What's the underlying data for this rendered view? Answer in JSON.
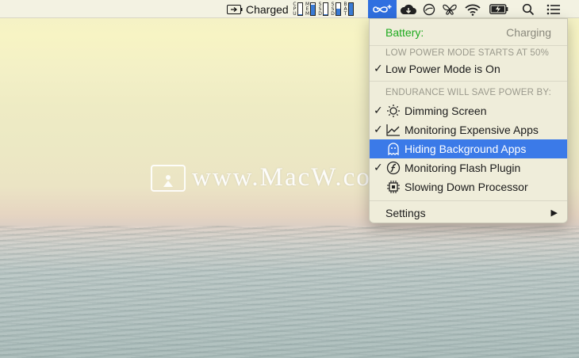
{
  "menubar": {
    "battery_status": "Charged",
    "stats": [
      {
        "label": "CPU",
        "level": 0.05,
        "fill_color": "#3a7bd5"
      },
      {
        "label": "MEM",
        "level": 0.85,
        "fill_color": "#3a7bd5"
      },
      {
        "label": "SSD",
        "level": 0.1,
        "fill_color": "#3a7bd5"
      },
      {
        "label": "SSD",
        "level": 0.55,
        "fill_color": "#3a7bd5"
      },
      {
        "label": "BAT",
        "level": 1.0,
        "fill_color": "#3a7bd5"
      }
    ],
    "icons": [
      "endurance-icon",
      "cloud-icon",
      "sync-icon",
      "butterfly-icon",
      "wifi-icon",
      "battery-charging-icon",
      "search-icon",
      "notification-list-icon"
    ]
  },
  "menu": {
    "battery_label": "Battery:",
    "battery_value": "Charging",
    "low_power_header": "LOW POWER MODE STARTS AT 50%",
    "low_power_item": "Low Power Mode is On",
    "endurance_header": "ENDURANCE WILL SAVE POWER BY:",
    "items": [
      {
        "label": "Dimming Screen",
        "checked": true,
        "icon": "brightness-icon"
      },
      {
        "label": "Monitoring Expensive Apps",
        "checked": true,
        "icon": "chart-line-icon"
      },
      {
        "label": "Hiding Background Apps",
        "checked": false,
        "icon": "ghost-icon",
        "highlighted": true
      },
      {
        "label": "Monitoring Flash Plugin",
        "checked": true,
        "icon": "flash-plugin-icon"
      },
      {
        "label": "Slowing Down Processor",
        "checked": false,
        "icon": "processor-icon"
      }
    ],
    "settings_label": "Settings",
    "check_mark": "✓",
    "submenu_arrow": "▶"
  },
  "watermark": {
    "text": "www.MacW.com"
  },
  "colors": {
    "accent": "#3b7ae8",
    "battery_green": "#1eaa1e"
  }
}
